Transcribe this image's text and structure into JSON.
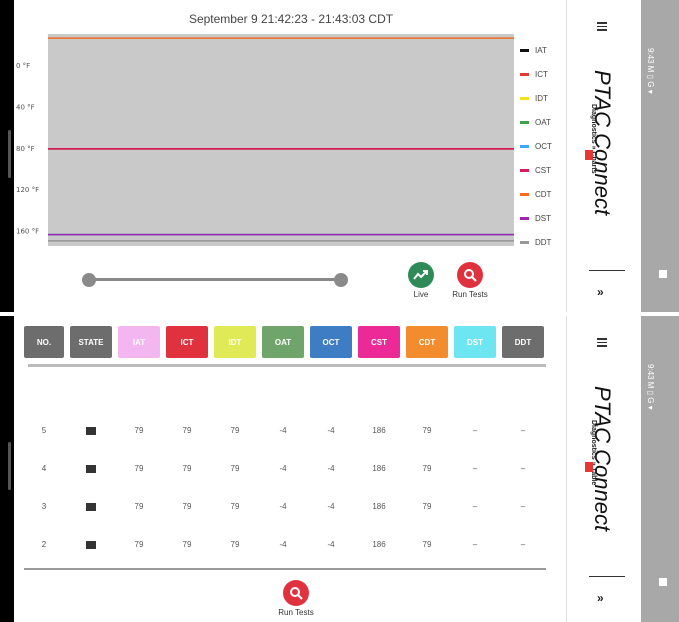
{
  "chart_screen": {
    "title": "September 9 21:42:23 - 21:43:03 CDT",
    "y_ticks": [
      "160 °F",
      "120 °F",
      "80 °F",
      "40 °F",
      "0 °F"
    ],
    "buttons": {
      "live_label": "Live",
      "run_tests_label": "Run Tests"
    },
    "slider": {
      "start": 0.0,
      "end": 1.0
    }
  },
  "chart_data": {
    "type": "line",
    "title": "September 9 21:42:23 - 21:43:03 CDT",
    "xlabel": "",
    "ylabel": "",
    "ylim": [
      -15,
      190
    ],
    "y_ticks": [
      0,
      40,
      80,
      120,
      160
    ],
    "grid": false,
    "legend_position": "right",
    "series": [
      {
        "name": "IAT",
        "color": "#111111",
        "values": [
          79,
          79
        ]
      },
      {
        "name": "ICT",
        "color": "#e53935",
        "values": [
          79,
          79
        ]
      },
      {
        "name": "IDT",
        "color": "#f2e21a",
        "values": [
          79,
          79
        ]
      },
      {
        "name": "OAT",
        "color": "#43a047",
        "values": [
          -4,
          -4
        ]
      },
      {
        "name": "OCT",
        "color": "#42a5f5",
        "values": [
          -4,
          -4
        ]
      },
      {
        "name": "CST",
        "color": "#d81b60",
        "values": [
          79,
          79
        ]
      },
      {
        "name": "CDT",
        "color": "#f36c21",
        "values": [
          186,
          186
        ]
      },
      {
        "name": "DST",
        "color": "#9c27b0",
        "values": [
          -4,
          -4
        ]
      },
      {
        "name": "DDT",
        "color": "#999999",
        "values": [
          -10,
          -10
        ]
      }
    ]
  },
  "side_panel": {
    "app_title": "PTAC Connect",
    "chart_subtitle": "Diagnostics » Charts",
    "table_subtitle": "Diagnostics » Table",
    "chevrons": "»",
    "status_text": "9:43 M ▯ G ▾"
  },
  "table": {
    "columns": [
      {
        "label": "NO.",
        "color": "#6d6d6d",
        "width": 40
      },
      {
        "label": "STATE",
        "color": "#6d6d6d",
        "width": 42
      },
      {
        "label": "IAT",
        "color": "#f4b6f0",
        "width": 42
      },
      {
        "label": "ICT",
        "color": "#e0323e",
        "width": 42
      },
      {
        "label": "IDT",
        "color": "#e0ea57",
        "width": 42
      },
      {
        "label": "OAT",
        "color": "#6fa56a",
        "width": 42
      },
      {
        "label": "OCT",
        "color": "#3e7cc4",
        "width": 42
      },
      {
        "label": "CST",
        "color": "#ec2a97",
        "width": 42
      },
      {
        "label": "CDT",
        "color": "#f28c2c",
        "width": 42
      },
      {
        "label": "DST",
        "color": "#6ee6f2",
        "width": 42
      },
      {
        "label": "DDT",
        "color": "#6d6d6d",
        "width": 42
      }
    ],
    "rows": [
      [
        "5",
        "",
        "79",
        "79",
        "79",
        "-4",
        "-4",
        "186",
        "79",
        "–",
        "–"
      ],
      [
        "4",
        "",
        "79",
        "79",
        "79",
        "-4",
        "-4",
        "186",
        "79",
        "–",
        "–"
      ],
      [
        "3",
        "",
        "79",
        "79",
        "79",
        "-4",
        "-4",
        "186",
        "79",
        "–",
        "–"
      ],
      [
        "2",
        "",
        "79",
        "79",
        "79",
        "-4",
        "-4",
        "186",
        "79",
        "–",
        "–"
      ]
    ],
    "run_tests_label": "Run Tests"
  },
  "icons": {
    "live": "trend-icon",
    "run_tests": "magnifier-icon",
    "menu": "hamburger-icon",
    "state": "unit-icon"
  }
}
